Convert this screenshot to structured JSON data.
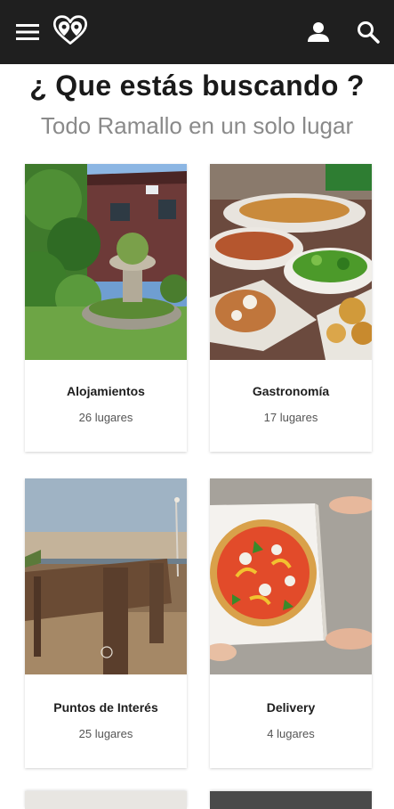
{
  "header": {
    "menu_icon": "hamburger-menu-icon",
    "logo": "double-pin-heart-logo",
    "user_icon": "user-icon",
    "search_icon": "search-icon",
    "background": "#1f1f1f"
  },
  "main": {
    "title": "¿ Que estás buscando ?",
    "subtitle": "Todo Ramallo en un solo lugar"
  },
  "categories": [
    {
      "name": "Alojamientos",
      "count": "26 lugares"
    },
    {
      "name": "Gastronomía",
      "count": "17 lugares"
    },
    {
      "name": "Puntos de Interés",
      "count": "25 lugares"
    },
    {
      "name": "Delivery",
      "count": "4 lugares"
    }
  ]
}
